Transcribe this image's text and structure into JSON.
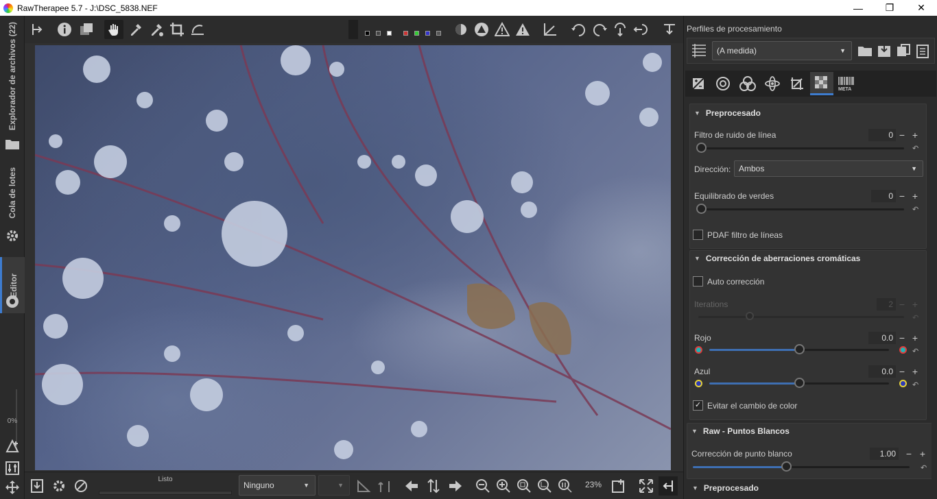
{
  "window": {
    "title": "RawTherapee 5.7 - J:\\DSC_5838.NEF"
  },
  "left_tabs": {
    "file_browser": "Explorador de archivos (22)",
    "queue": "Cola de lotes",
    "editor": "Editor",
    "zoom_percent": "0%"
  },
  "bottom": {
    "status": "Listo",
    "preset_combo": "Ninguno",
    "zoom": "23%"
  },
  "right": {
    "profiles_title": "Perfiles de procesamiento",
    "profile_value": "(A medida)",
    "preprocess": {
      "title": "Preprocesado",
      "line_noise_label": "Filtro de ruido de línea",
      "line_noise_value": "0",
      "direction_label": "Dirección:",
      "direction_value": "Ambos",
      "green_eq_label": "Equilibrado de verdes",
      "green_eq_value": "0",
      "pdaf_label": "PDAF filtro de líneas"
    },
    "ca": {
      "title": "Corrección de aberraciones cromáticas",
      "auto_label": "Auto corrección",
      "iterations_label": "Iterations",
      "iterations_value": "2",
      "red_label": "Rojo",
      "red_value": "0.0",
      "red_fraction": 0.5,
      "blue_label": "Azul",
      "blue_value": "0.0",
      "blue_fraction": 0.5,
      "avoid_shift_label": "Evitar el cambio de color"
    },
    "white_points": {
      "title": "Raw - Puntos Blancos",
      "label": "Corrección de punto blanco",
      "value": "1.00",
      "fraction": 0.43
    },
    "preprocess2": {
      "title": "Preprocesado"
    }
  },
  "symbols": {
    "minus": "−",
    "plus": "+",
    "reset": "↶",
    "triangle": "▼",
    "check": "✓",
    "arrow": "▼",
    "close": "✕",
    "restore": "❐",
    "minimize": "—"
  }
}
